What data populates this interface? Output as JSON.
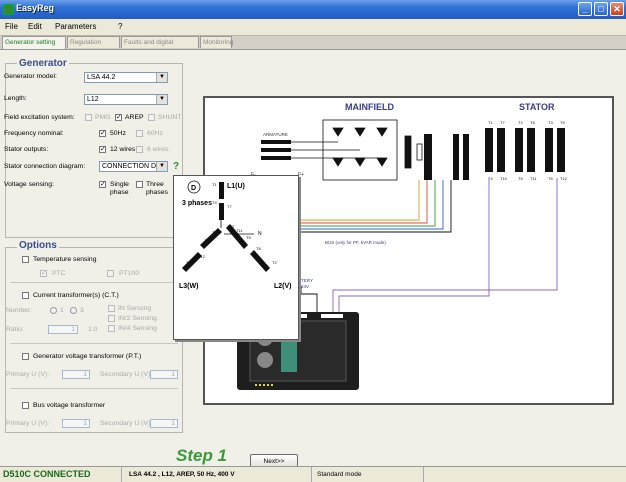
{
  "window": {
    "title": "EasyReg"
  },
  "menu": [
    "File",
    "Edit",
    "Parameters",
    "?"
  ],
  "tabs": [
    "Generator setting",
    "Regulation mode",
    "Faults and digital outputs",
    "Monitoring"
  ],
  "generator": {
    "heading": "Generator",
    "model_label": "Generator model:",
    "model_value": "LSA 44.2",
    "length_label": "Length:",
    "length_value": "L12",
    "excitation_label": "Field excitation system:",
    "excitation_opts": [
      "PMG",
      "AREP",
      "SHUNT"
    ],
    "frequency_label": "Frequency nominal:",
    "frequency_opts": [
      "50Hz",
      "60Hz"
    ],
    "outputs_label": "Stator outputs:",
    "outputs_opts": [
      "12 wires",
      "6 wires"
    ],
    "connection_label": "Stator connection diagram:",
    "connection_value": "CONNECTION D",
    "help": "?",
    "voltage_sensing_label": "Voltage sensing:",
    "voltage_sensing_opts": [
      "Single phase",
      "Three phases"
    ]
  },
  "options": {
    "heading": "Options",
    "temp_label": "Temperature sensing",
    "ptc": "PTC",
    "pt100": "PT100",
    "ct_label": "Current transformer(s) (C.T.)",
    "number_label": "Number:",
    "number_opts": [
      "1",
      "3"
    ],
    "ratio_label": "Ratio:",
    "ratio_value": "1",
    "ratio_unit": "1:0",
    "sensing_opts": [
      "IN Sensing",
      "IN/2 Sensing",
      "IN/4 Sensing"
    ],
    "pt_label": "Generator voltage transformer (P.T.)",
    "primary_label": "Primary U (V):",
    "secondary_label": "Secondary U (V):",
    "primary_value": "1",
    "secondary_value": "1",
    "bus_label": "Bus voltage transformer",
    "bus_primary_value": "1",
    "bus_secondary_value": "1"
  },
  "diagram": {
    "mainfield": "MAINFIELD",
    "stator": "STATOR",
    "armature": "ARMATURE",
    "f_minus": "F-",
    "f_plus": "F+",
    "bus_note": "BUS (only for PF, kVAR mode)",
    "battery": "TERY",
    "battery2": "24V",
    "terminals_top": [
      "T1",
      "T7",
      "T2",
      "T8",
      "T3",
      "T9"
    ],
    "terminals_bottom": [
      "T4",
      "T10",
      "T5",
      "T11",
      "T6",
      "T12"
    ]
  },
  "popup": {
    "letter": "D",
    "phases": "3 phases",
    "l1": "L1(U)",
    "l2": "L2(V)",
    "l3": "L3(W)",
    "n": "N",
    "t_labels": [
      "T1",
      "T4",
      "T7",
      "T10",
      "T6",
      "T9",
      "T3",
      "T12",
      "T5",
      "T11",
      "T2",
      "T8"
    ]
  },
  "footer": {
    "step": "Step 1",
    "next": "Next>>"
  },
  "status": {
    "device": "D510C CONNECTED",
    "config": "LSA 44.2 , L12, AREP, 50 Hz, 400 V",
    "mode": "Standard mode"
  }
}
